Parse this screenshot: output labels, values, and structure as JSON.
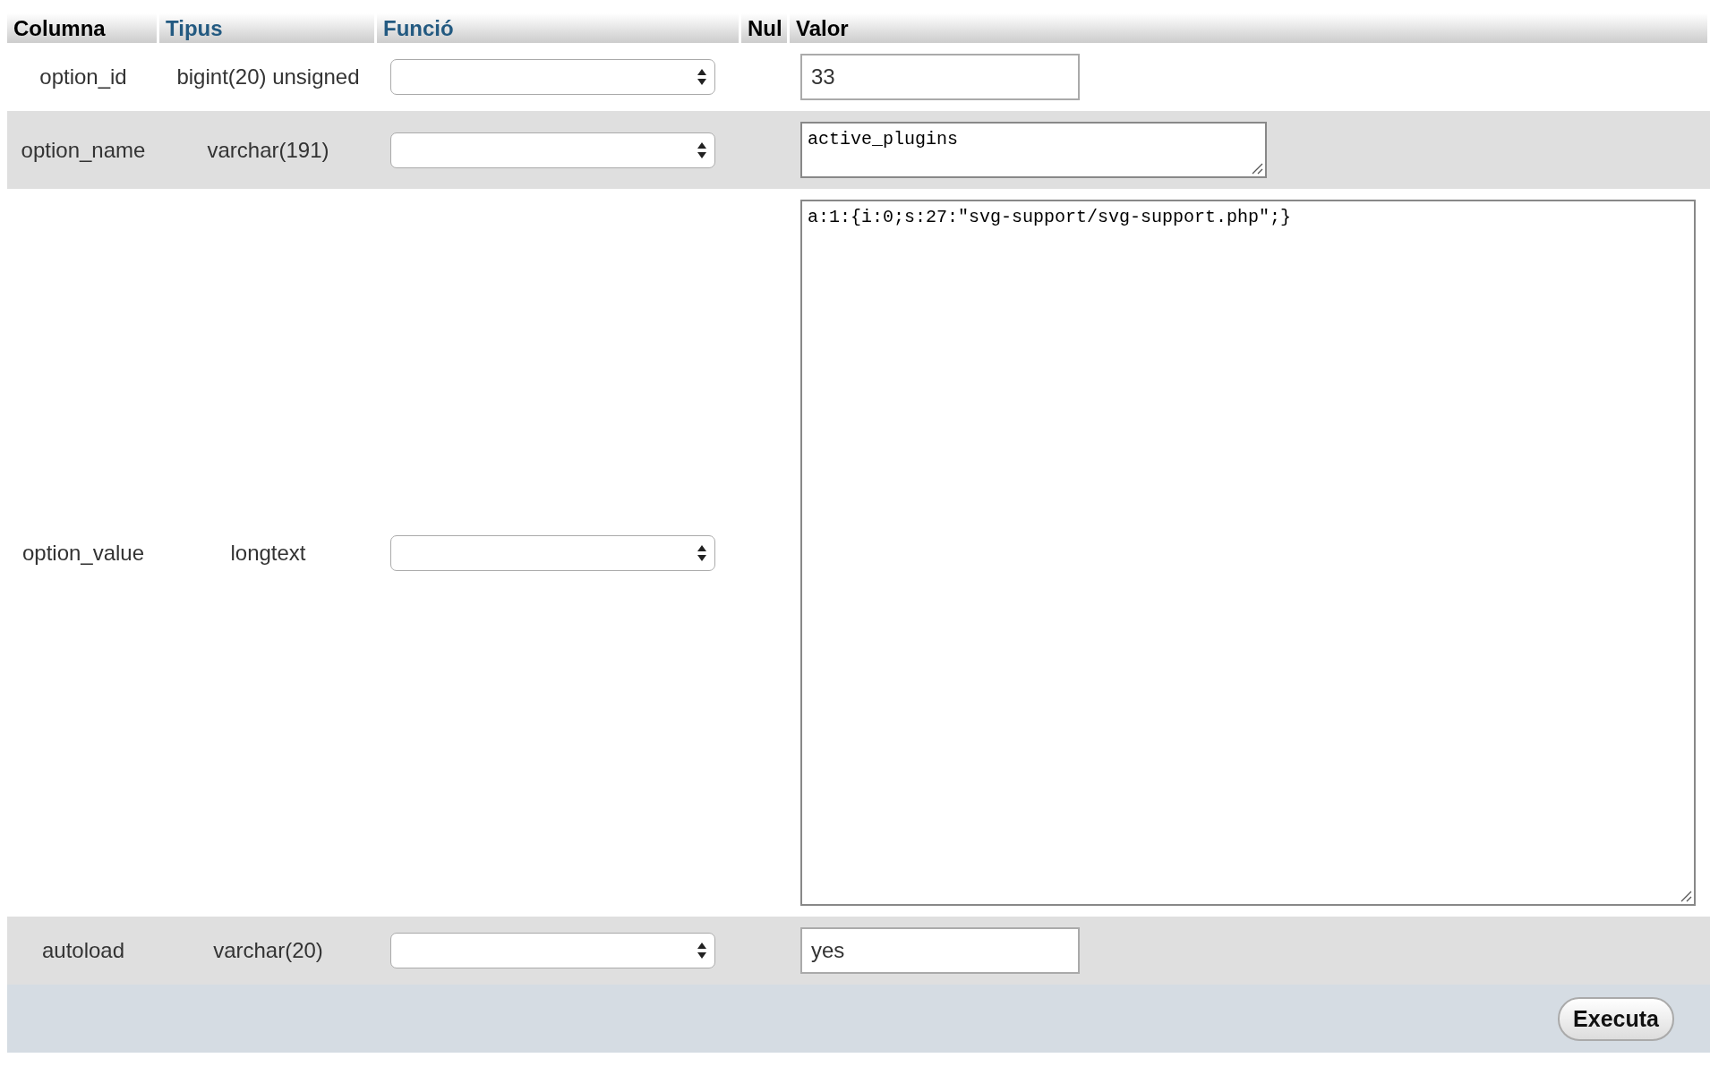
{
  "table": {
    "columns": [
      {
        "label": "Columna",
        "kind": "plain"
      },
      {
        "label": "Tipus",
        "kind": "link"
      },
      {
        "label": "Funció",
        "kind": "link"
      },
      {
        "label": "Nul",
        "kind": "plain"
      },
      {
        "label": "Valor",
        "kind": "plain"
      }
    ],
    "rows": [
      {
        "column": "option_id",
        "type": "bigint(20) unsigned",
        "value": "33",
        "kind": "input"
      },
      {
        "column": "option_name",
        "type": "varchar(191)",
        "value": "active_plugins",
        "kind": "textarea-small"
      },
      {
        "column": "option_value",
        "type": "longtext",
        "value": "a:1:{i:0;s:27:\"svg-support/svg-support.php\";}",
        "kind": "textarea-large"
      },
      {
        "column": "autoload",
        "type": "varchar(20)",
        "value": "yes",
        "kind": "input"
      }
    ]
  },
  "footer": {
    "button": "Executa"
  }
}
